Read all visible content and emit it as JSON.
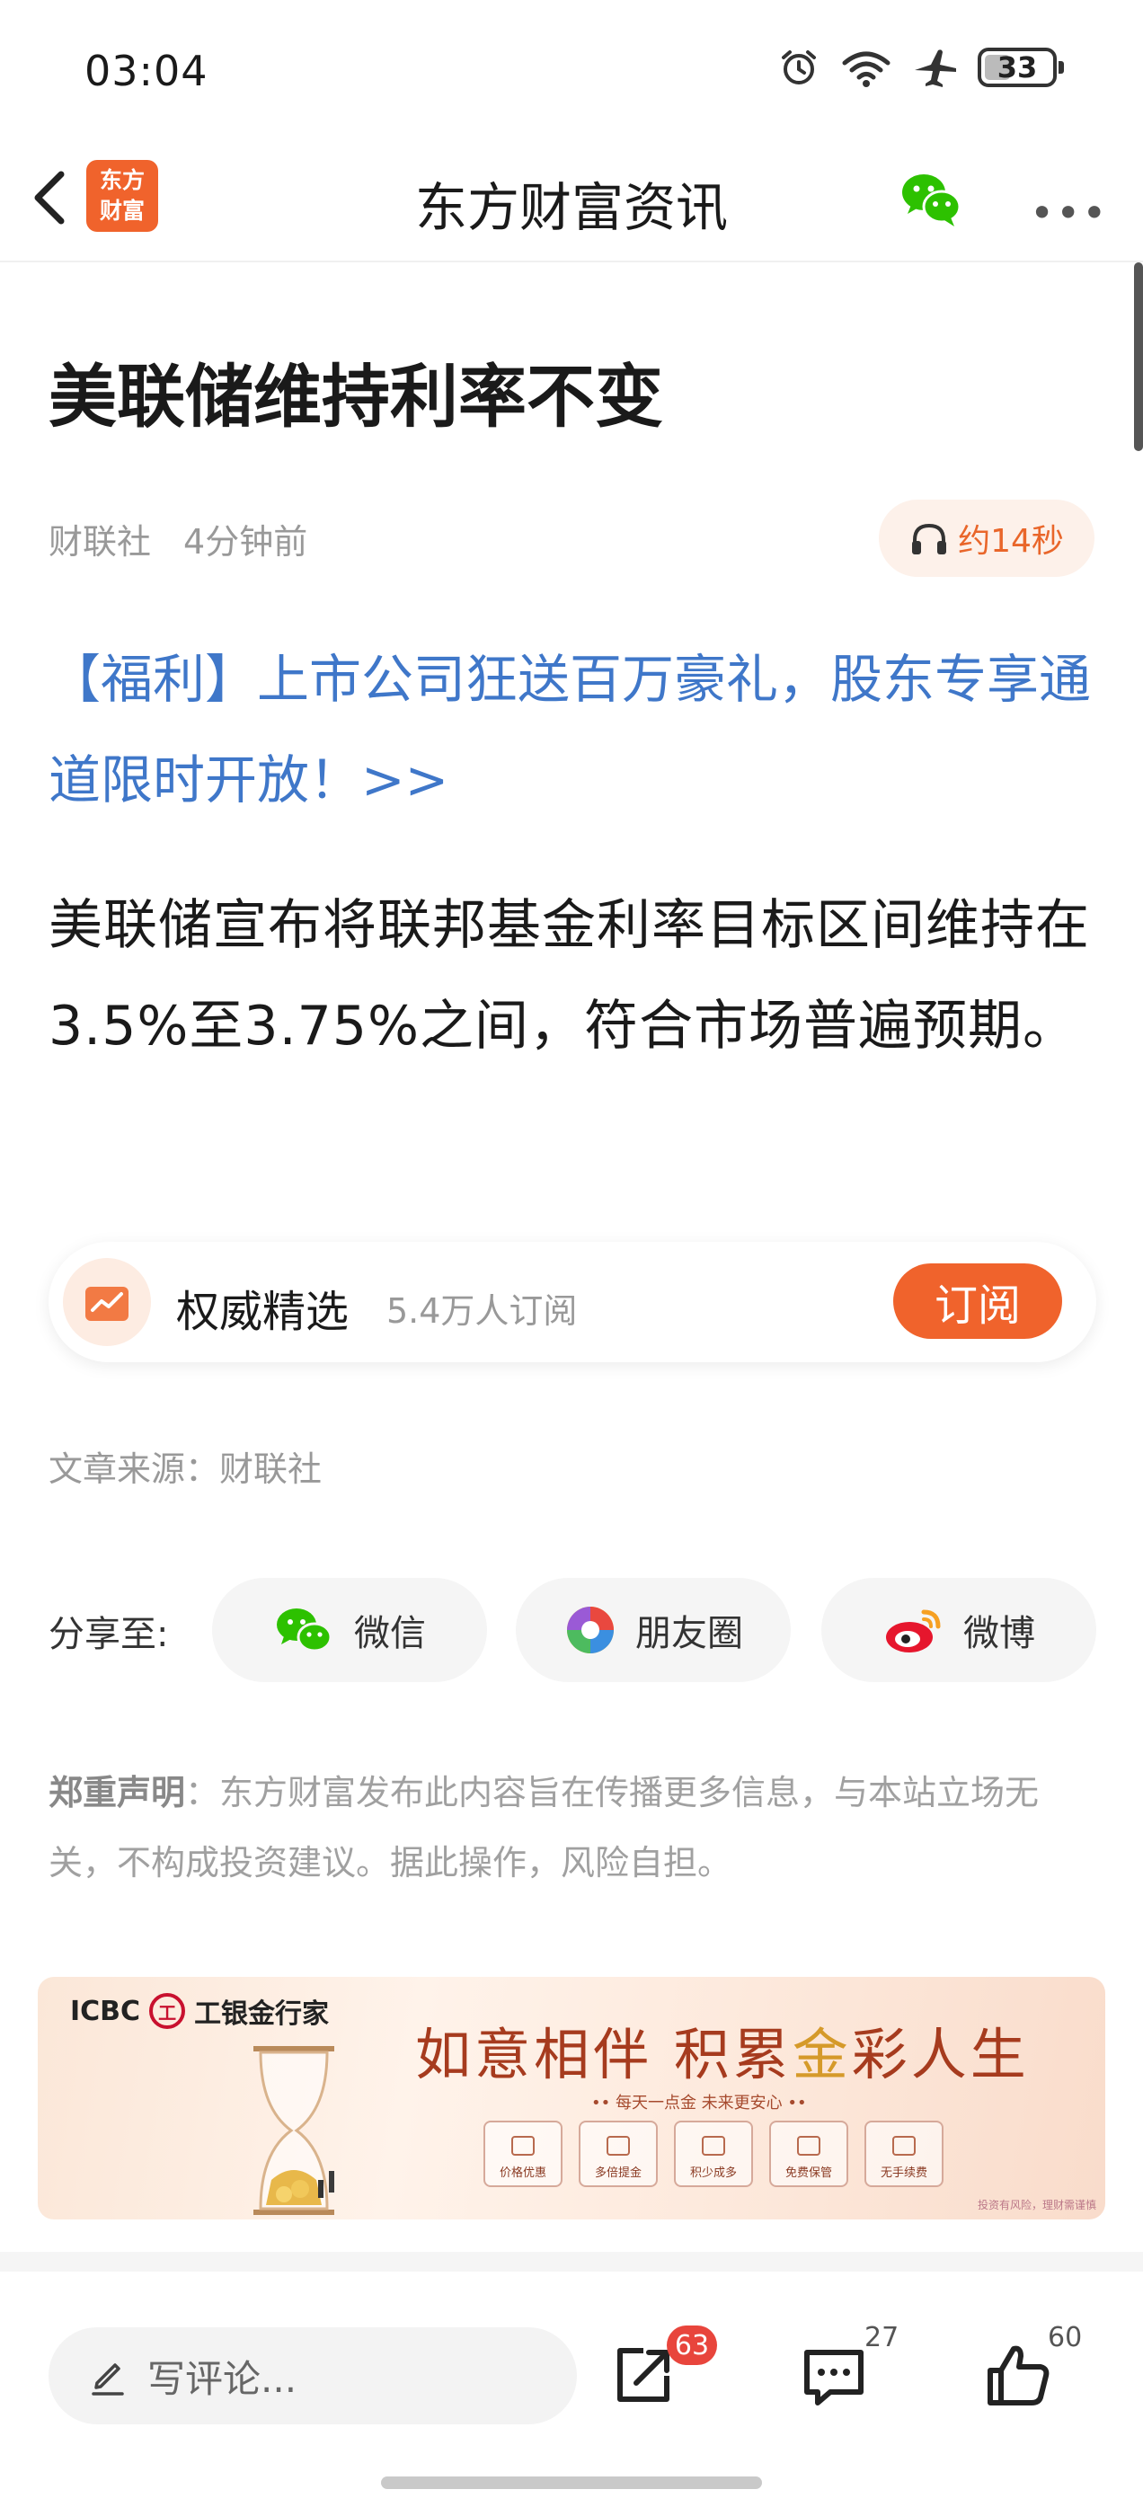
{
  "status_bar": {
    "time": "03:04",
    "battery": "33"
  },
  "nav": {
    "title": "东方财富资讯",
    "logo_line1": "东方",
    "logo_line2": "财富"
  },
  "article": {
    "title": "美联储维持利率不变",
    "source": "财联社",
    "time_ago": "4分钟前",
    "audio_duration": "约14秒",
    "promo_link": "【福利】上市公司狂送百万豪礼，股东专享通道限时开放！>>",
    "body": "美联储宣布将联邦基金利率目标区间维持在3.5%至3.75%之间，符合市场普遍预期。",
    "source_line": "文章来源：财联社"
  },
  "subscription": {
    "name": "权威精选",
    "subscribers": "5.4万人订阅",
    "button": "订阅"
  },
  "share": {
    "label": "分享至:",
    "options": [
      {
        "label": "微信",
        "icon": "wechat-icon"
      },
      {
        "label": "朋友圈",
        "icon": "moments-icon"
      },
      {
        "label": "微博",
        "icon": "weibo-icon"
      }
    ]
  },
  "disclaimer": {
    "heading": "郑重声明",
    "text": "：东方财富发布此内容旨在传播更多信息，与本站立场无关，不构成投资建议。据此操作，风险自担。"
  },
  "ad": {
    "brand": "ICBC",
    "brand_mark": "工",
    "brand_product": "工银金行家",
    "slogan_part1": "如意相伴 积累",
    "slogan_gold": "金",
    "slogan_part2": "彩人生",
    "subtitle": "•• 每天一点金  未来更安心 ••",
    "features": [
      "价格优惠",
      "多倍提金",
      "积少成多",
      "免费保管",
      "无手续费"
    ],
    "footer": "投资有风险，理财需谨慎"
  },
  "bottom_bar": {
    "comment_placeholder": "写评论...",
    "share_count": "63",
    "comment_count": "27",
    "like_count": "60"
  }
}
